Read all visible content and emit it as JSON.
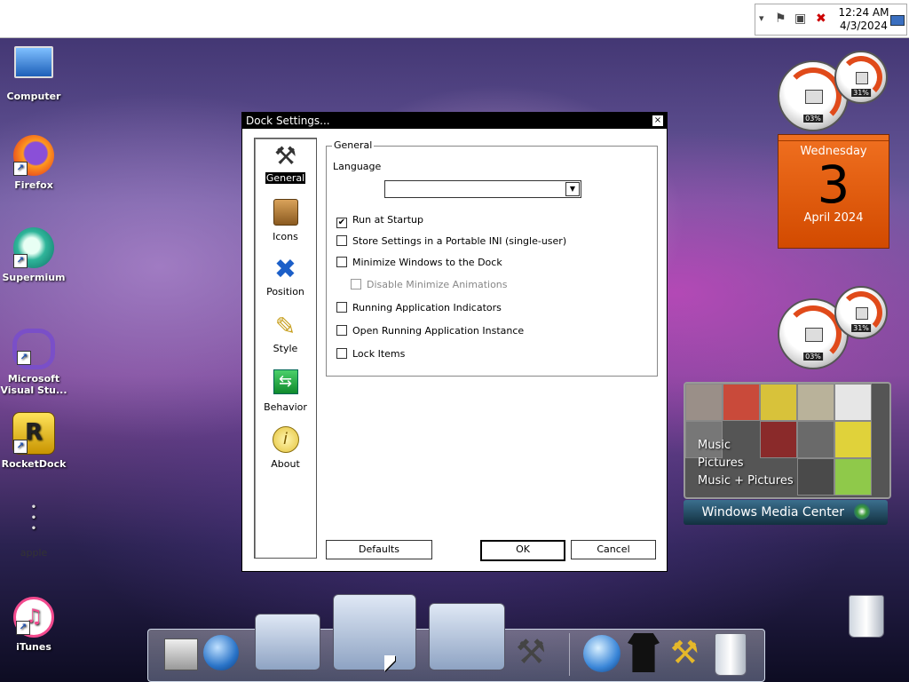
{
  "menubar": {
    "tray": {
      "time": "12:24 AM",
      "date": "4/3/2024"
    }
  },
  "desktop_icons": [
    {
      "label": "Computer"
    },
    {
      "label": "Firefox"
    },
    {
      "label": "Supermium"
    },
    {
      "label": "Microsoft Visual Stu..."
    },
    {
      "label": "RocketDock"
    },
    {
      "label": "apple"
    },
    {
      "label": "iTunes"
    }
  ],
  "dialog": {
    "title": "Dock Settings...",
    "close_label": "×",
    "nav": [
      {
        "label": "General",
        "icon": "tools-icon",
        "selected": true
      },
      {
        "label": "Icons",
        "icon": "box-icon"
      },
      {
        "label": "Position",
        "icon": "arrows-icon"
      },
      {
        "label": "Style",
        "icon": "brush-icon"
      },
      {
        "label": "Behavior",
        "icon": "behavior-icon"
      },
      {
        "label": "About",
        "icon": "info-icon"
      }
    ],
    "group_title": "General",
    "language_label": "Language",
    "language_value": "",
    "options": [
      {
        "label": "Run at Startup",
        "checked": true
      },
      {
        "label": "Store Settings in a Portable INI (single-user)",
        "checked": false
      },
      {
        "label": "Minimize Windows to the Dock",
        "checked": false
      },
      {
        "label": "Disable Minimize Animations",
        "checked": false,
        "disabled": true
      },
      {
        "label": "Running Application Indicators",
        "checked": false
      },
      {
        "label": "Open Running Application Instance",
        "checked": false
      },
      {
        "label": "Lock Items",
        "checked": false
      }
    ],
    "buttons": {
      "defaults": "Defaults",
      "ok": "OK",
      "cancel": "Cancel"
    }
  },
  "gadgets": {
    "cpu_meter_top": {
      "cpu": "03%",
      "ram": "31%"
    },
    "calendar": {
      "weekday": "Wednesday",
      "day": "3",
      "month_year": "April 2024"
    },
    "cpu_meter_bottom": {
      "cpu": "03%",
      "ram": "31%"
    },
    "media_center": {
      "items": [
        "Music",
        "Pictures",
        "Music + Pictures"
      ],
      "brand": "Windows Media Center"
    }
  },
  "colors": {
    "calendar": "#e8661a",
    "dialog_title": "#000000",
    "accent": "#e04a1a"
  }
}
